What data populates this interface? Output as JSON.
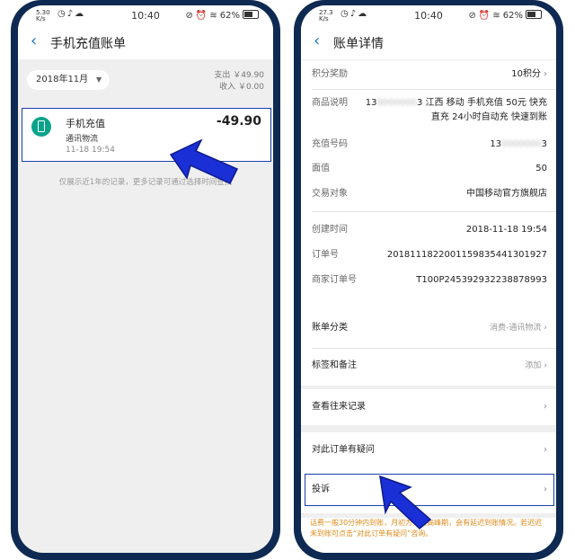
{
  "status_left": {
    "net_speed": "5.30",
    "net_unit": "K/s",
    "time": "10:40",
    "battery": "62%"
  },
  "status_right": {
    "net_speed": "27.3",
    "net_unit": "K/s",
    "time": "10:40",
    "battery": "62%"
  },
  "left_screen": {
    "title": "手机充值账单",
    "month": "2018年11月",
    "expense": "支出 ￥49.90",
    "income": "收入 ￥0.00",
    "bill": {
      "name": "手机充值",
      "category": "通讯物流",
      "time": "11-18  19:54",
      "amount": "-49.90"
    },
    "hint": "仅展示近1年的记录，更多记录可通过选择时间查找"
  },
  "right_screen": {
    "title": "账单详情",
    "points_label": "积分奖励",
    "points_value": "10积分",
    "desc_label": "商品说明",
    "desc_value_prefix": "13",
    "desc_value_masked": "0000000",
    "desc_value_rest": "3 江西 移动 手机充值 50元 快充直充 24小时自动充 快速到账",
    "phone_label": "充值号码",
    "phone_prefix": "13",
    "phone_masked": "0000000",
    "phone_suffix": "3",
    "face_label": "面值",
    "face_value": "50",
    "party_label": "交易对象",
    "party_value": "中国移动官方旗舰店",
    "created_label": "创建时间",
    "created_value": "2018-11-18 19:54",
    "order_label": "订单号",
    "order_value": "20181118220011598354413019​27",
    "merchant_order_label": "商家订单号",
    "merchant_order_value": "T100P245392932238878993",
    "category_label": "账单分类",
    "category_value": "消费-通讯物流",
    "tag_label": "标签和备注",
    "tag_value": "添加",
    "history_label": "查看往来记录",
    "question_label": "对此订单有疑问",
    "complaint_label": "投诉",
    "notice": "话费一般30分钟内到账，月初为充值高峰期，会有延迟到账情况。若迟迟未到账可点击“对此订单有疑问”咨询。"
  },
  "colors": {
    "frame": "#0e2a52",
    "highlight_border": "#1c3fae",
    "arrow": "#1a2fd6",
    "accent_blue": "#1a73c9",
    "icon_green": "#0aa38a",
    "notice_orange": "#e08a1a"
  },
  "icons": [
    "back-chevron-icon",
    "phone-topup-icon",
    "chevron-right-icon",
    "wifi-icon",
    "battery-icon",
    "mute-icon",
    "clock-icon"
  ]
}
